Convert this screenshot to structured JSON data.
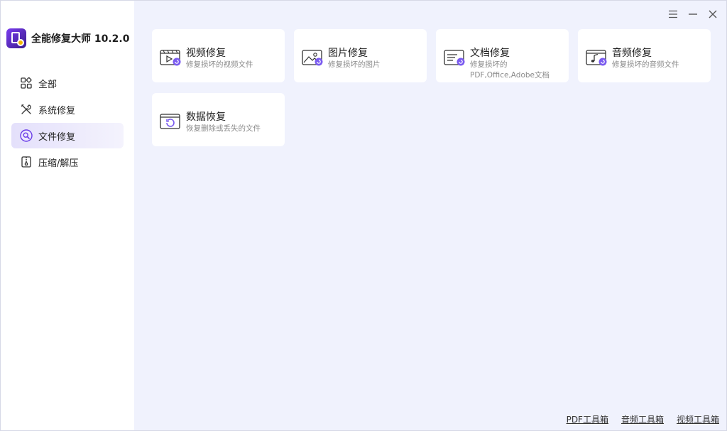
{
  "app": {
    "title": "全能修复大师 10.2.0"
  },
  "sidebar": {
    "items": [
      {
        "label": "全部",
        "icon": "grid-icon"
      },
      {
        "label": "系统修复",
        "icon": "tools-icon"
      },
      {
        "label": "文件修复",
        "icon": "file-search-icon",
        "active": true
      },
      {
        "label": "压缩/解压",
        "icon": "zip-icon"
      }
    ]
  },
  "window_controls": {
    "menu": "≡",
    "minimize": "—",
    "close": "✕"
  },
  "cards": [
    {
      "title": "视频修复",
      "desc": "修复损坏的视频文件",
      "icon": "video-repair-icon"
    },
    {
      "title": "图片修复",
      "desc": "修复损坏的图片",
      "icon": "image-repair-icon"
    },
    {
      "title": "文档修复",
      "desc": "修复损坏的PDF,Office,Adobe文档",
      "icon": "document-repair-icon"
    },
    {
      "title": "音频修复",
      "desc": "修复损坏的音频文件",
      "icon": "audio-repair-icon"
    },
    {
      "title": "数据恢复",
      "desc": "恢复删除或丢失的文件",
      "icon": "data-recovery-icon"
    }
  ],
  "footer": {
    "links": [
      "PDF工具箱",
      "音频工具箱",
      "视频工具箱"
    ]
  },
  "colors": {
    "accent": "#6a3de8",
    "badge": "#7b5cf0",
    "sidebar_active": "#e4e0fb",
    "background": "#f0f2fd"
  }
}
